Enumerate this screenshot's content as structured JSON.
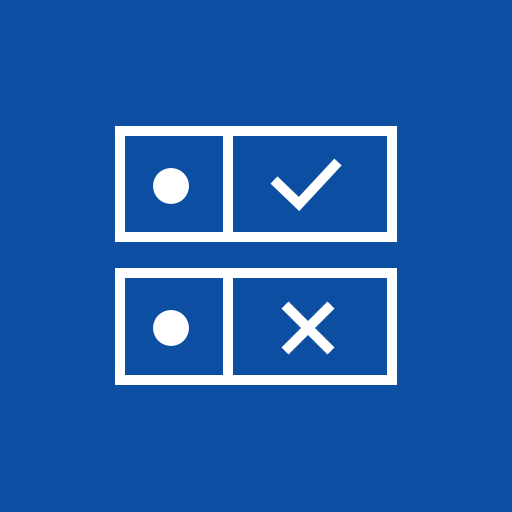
{
  "icon": {
    "name": "checklist-app-icon",
    "background_color": "#0B4EA2",
    "foreground_color": "#FFFFFF",
    "rows": [
      {
        "row_name": "row-approved",
        "bullet_icon": "dot-icon",
        "status_icon": "checkmark-icon"
      },
      {
        "row_name": "row-rejected",
        "bullet_icon": "dot-icon",
        "status_icon": "cross-icon"
      }
    ]
  }
}
